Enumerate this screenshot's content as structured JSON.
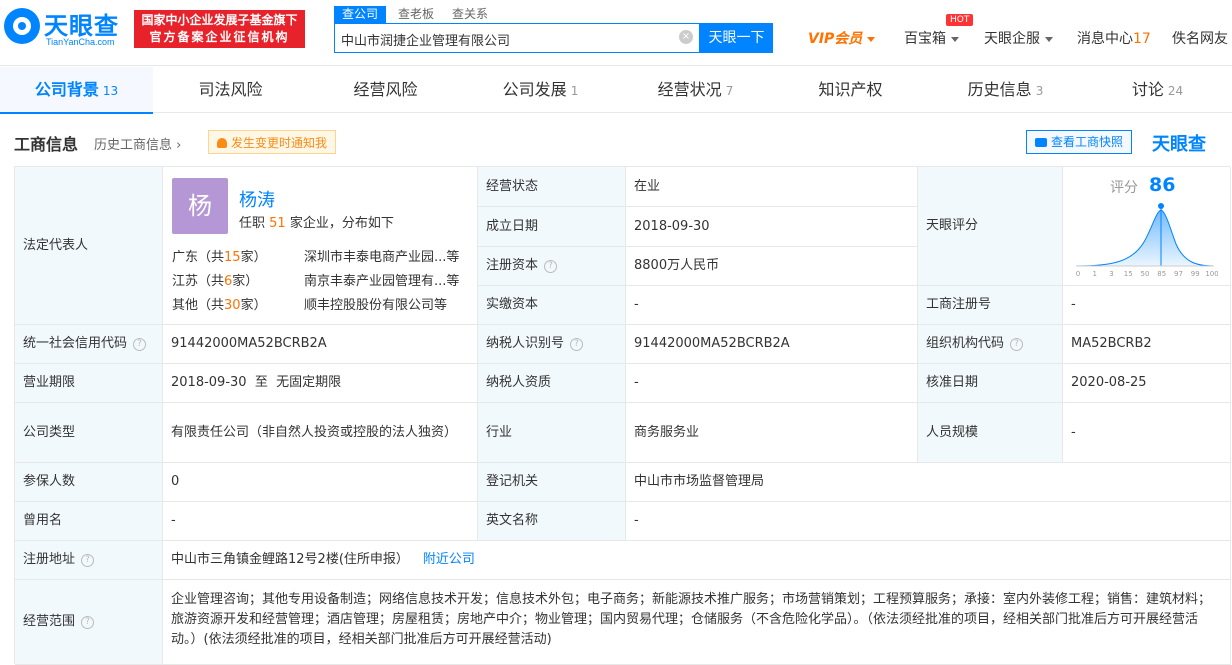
{
  "header": {
    "logo_text": "天眼查",
    "logo_sub": "TianYanCha.com",
    "badge_line1": "国家中小企业发展子基金旗下",
    "badge_line2": "官方备案企业征信机构",
    "search_tabs": [
      "查公司",
      "查老板",
      "查关系"
    ],
    "search_value": "中山市润捷企业管理有限公司",
    "search_button": "天眼一下",
    "nav": {
      "vip": "VIP会员",
      "baibao": "百宝箱",
      "hot": "HOT",
      "qifu": "天眼企服",
      "msg": "消息中心",
      "msg_count": "17",
      "user": "佚名网友"
    }
  },
  "tabs": [
    {
      "label": "公司背景",
      "count": "13"
    },
    {
      "label": "司法风险",
      "count": ""
    },
    {
      "label": "经营风险",
      "count": ""
    },
    {
      "label": "公司发展",
      "count": "1"
    },
    {
      "label": "经营状况",
      "count": "7"
    },
    {
      "label": "知识产权",
      "count": ""
    },
    {
      "label": "历史信息",
      "count": "3"
    },
    {
      "label": "讨论",
      "count": "24"
    }
  ],
  "section": {
    "title": "工商信息",
    "history": "历史工商信息",
    "notify": "发生变更时通知我",
    "snapshot": "查看工商快照",
    "brand": "天眼查"
  },
  "legal_rep": {
    "label": "法定代表人",
    "avatar": "杨",
    "name": "杨涛",
    "sub_prefix": "任职",
    "sub_count": "51",
    "sub_suffix": "家企业，分布如下",
    "dist": [
      {
        "region": "广东（共",
        "num": "15",
        "unit": "家）",
        "company": "深圳市丰泰电商产业园...等"
      },
      {
        "region": "江苏（共",
        "num": "6",
        "unit": "家）",
        "company": "南京丰泰产业园管理有...等"
      },
      {
        "region": "其他（共",
        "num": "30",
        "unit": "家）",
        "company": "顺丰控股股份有限公司等"
      }
    ]
  },
  "fields": {
    "status_lbl": "经营状态",
    "status": "在业",
    "estab_lbl": "成立日期",
    "estab": "2018-09-30",
    "capital_lbl": "注册资本",
    "capital": "8800万人民币",
    "paid_lbl": "实缴资本",
    "paid": "-",
    "score_lbl": "天眼评分",
    "score_text": "评分",
    "score": "86",
    "reg_no_lbl": "工商注册号",
    "reg_no": "-",
    "credit_lbl": "统一社会信用代码",
    "credit": "91442000MA52BCRB2A",
    "tax_lbl": "纳税人识别号",
    "tax": "91442000MA52BCRB2A",
    "org_lbl": "组织机构代码",
    "org": "MA52BCRB2",
    "term_lbl": "营业期限",
    "term": "2018-09-30  至  无固定期限",
    "taxq_lbl": "纳税人资质",
    "taxq": "-",
    "approve_lbl": "核准日期",
    "approve": "2020-08-25",
    "type_lbl": "公司类型",
    "type": "有限责任公司（非自然人投资或控股的法人独资）",
    "industry_lbl": "行业",
    "industry": "商务服务业",
    "staff_lbl": "人员规模",
    "staff": "-",
    "insured_lbl": "参保人数",
    "insured": "0",
    "authority_lbl": "登记机关",
    "authority": "中山市市场监督管理局",
    "former_lbl": "曾用名",
    "former": "-",
    "english_lbl": "英文名称",
    "english": "-",
    "addr_lbl": "注册地址",
    "addr": "中山市三角镇金鲤路12号2楼(住所申报）",
    "addr_link": "附近公司",
    "scope_lbl": "经营范围",
    "scope": "企业管理咨询；其他专用设备制造；网络信息技术开发；信息技术外包；电子商务；新能源技术推广服务；市场营销策划；工程预算服务；承接：室内外装修工程；销售：建筑材料；旅游资源开发和经营管理；酒店管理；房屋租赁；房地产中介；物业管理；国内贸易代理；仓储服务（不含危险化学品）。（依法须经批准的项目，经相关部门批准后方可开展经营活动。）(依法须经批准的项目，经相关部门批准后方可开展经营活动)"
  },
  "score_axis": [
    "0",
    "1",
    "3",
    "15",
    "50",
    "85",
    "97",
    "99",
    "100"
  ],
  "colors": {
    "accent": "#0084ff",
    "label_bg": "#f2f9fc",
    "orange": "#ff7200",
    "red": "#e8222a"
  }
}
